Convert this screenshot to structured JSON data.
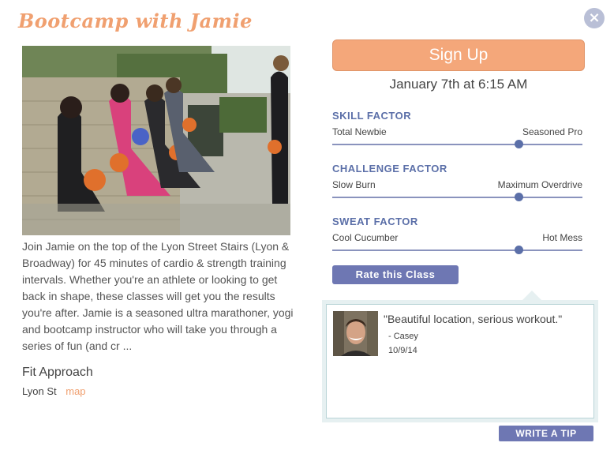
{
  "class": {
    "title": "Bootcamp with Jamie",
    "description": "Join Jamie on the top of the Lyon Street Stairs (Lyon & Broadway) for 45 minutes of cardio & strength training intervals. Whether you're an athlete or looking to get back in shape, these classes will get you the results you're after. Jamie is a seasoned ultra marathoner, yogi and bootcamp instructor who will take you through a series of fun (and cr ...",
    "studio": "Fit Approach",
    "location": "Lyon St",
    "map_link": "map"
  },
  "actions": {
    "close_icon": "×",
    "signup_label": "Sign Up",
    "rate_label": "Rate this Class",
    "write_tip_label": "WRITE A TIP"
  },
  "schedule": {
    "date_time": "January 7th at 6:15 AM"
  },
  "factors": [
    {
      "title": "SKILL FACTOR",
      "low_label": "Total Newbie",
      "high_label": "Seasoned Pro",
      "value_fraction": 0.745
    },
    {
      "title": "CHALLENGE FACTOR",
      "low_label": "Slow Burn",
      "high_label": "Maximum Overdrive",
      "value_fraction": 0.745
    },
    {
      "title": "SWEAT FACTOR",
      "low_label": "Cool Cucumber",
      "high_label": "Hot Mess",
      "value_fraction": 0.745
    }
  ],
  "tips": [
    {
      "quote": "\"Beautiful location, serious workout.\"",
      "author": "- Casey",
      "date": "10/9/14"
    }
  ],
  "colors": {
    "accent_orange": "#f4a77a",
    "accent_blue": "#5b6fa8",
    "button_blue": "#6e77b3"
  }
}
